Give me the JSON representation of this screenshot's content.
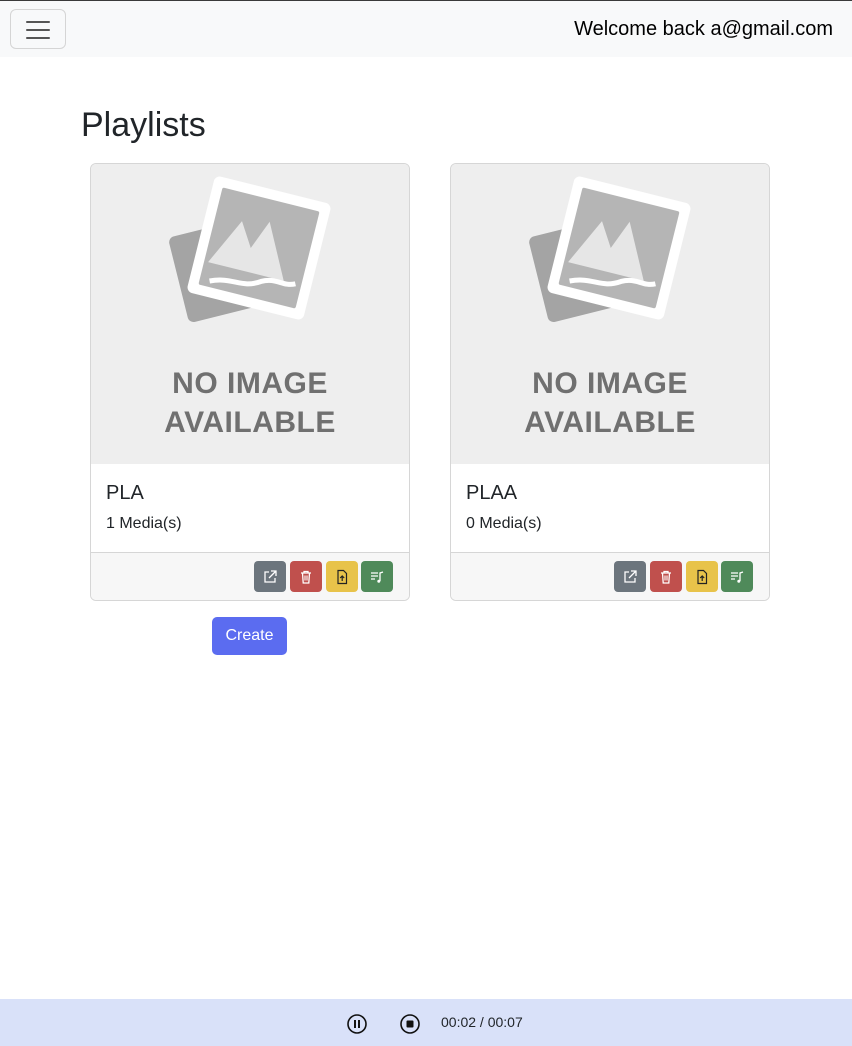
{
  "navbar": {
    "toggler_icon": "hamburger-icon",
    "welcome": "Welcome back a@gmail.com"
  },
  "page": {
    "title": "Playlists"
  },
  "placeholder_image": {
    "line1": "NO IMAGE",
    "line2": "AVAILABLE"
  },
  "playlists": [
    {
      "name": "PLA",
      "media_count": "1 Media(s)"
    },
    {
      "name": "PLAA",
      "media_count": "0 Media(s)"
    }
  ],
  "card_actions": {
    "open_icon": "external-link-icon",
    "delete_icon": "trash-icon",
    "upload_icon": "file-upload-icon",
    "play_icon": "music-playlist-icon",
    "colors": {
      "open": "#6c757d",
      "delete": "#c0504d",
      "upload": "#e8c34a",
      "play": "#4f8a5a"
    }
  },
  "create_button": {
    "label": "Create",
    "color": "#5b6cf0"
  },
  "player": {
    "pause_icon": "pause-circle-icon",
    "stop_icon": "stop-circle-icon",
    "time": "00:02 / 00:07",
    "background": "#d9e1f9"
  }
}
